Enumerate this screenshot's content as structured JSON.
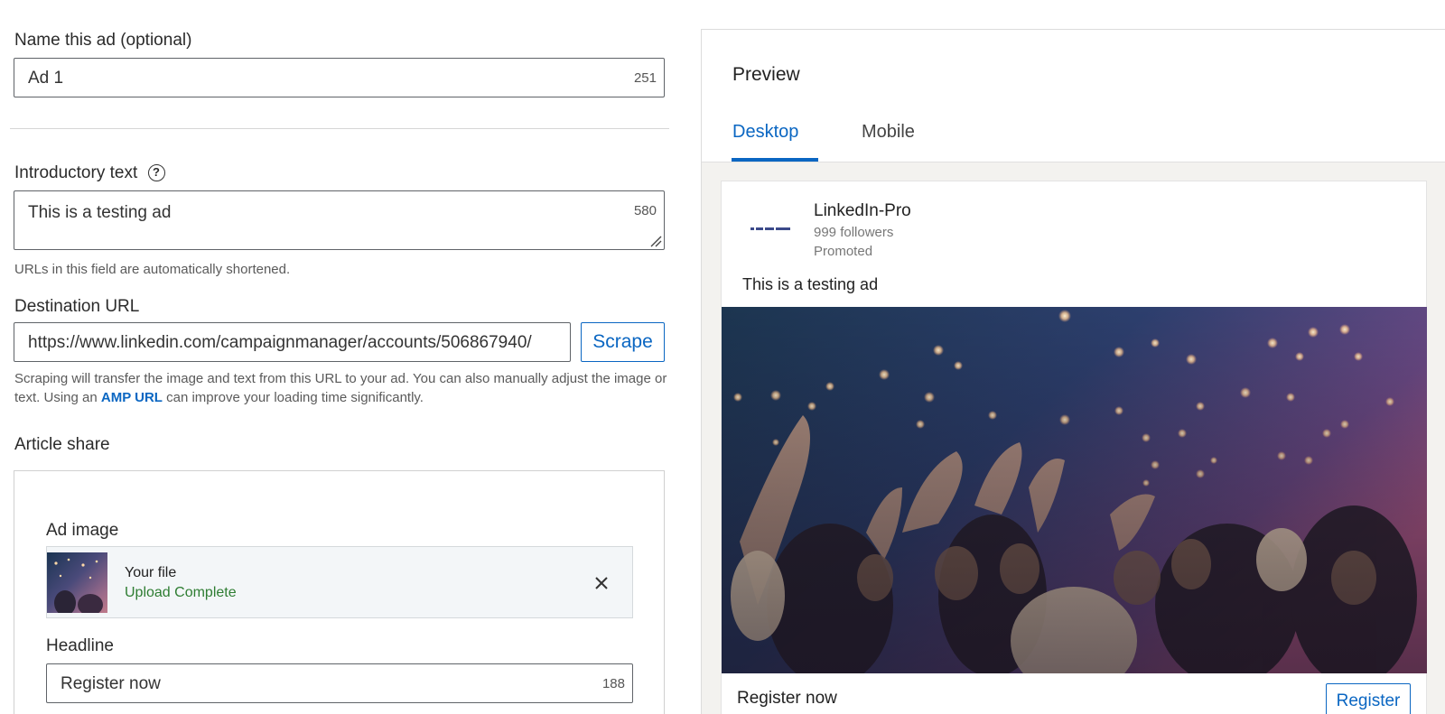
{
  "form": {
    "name_label": "Name this ad (optional)",
    "name_value": "Ad 1",
    "name_counter": "251",
    "intro_label": "Introductory text",
    "intro_value": "This is a testing ad",
    "intro_counter": "580",
    "intro_help": "URLs in this field are automatically shortened.",
    "dest_label": "Destination URL",
    "dest_value": "https://www.linkedin.com/campaignmanager/accounts/506867940/",
    "scrape_label": "Scrape",
    "scrape_help_pre": "Scraping will transfer the image and text from this URL to your ad. You can also manually adjust the image or text. Using an ",
    "scrape_help_link": "AMP URL",
    "scrape_help_post": " can improve your loading time significantly.",
    "article_share_label": "Article share",
    "ad_image_label": "Ad image",
    "file_name": "Your file",
    "file_status": "Upload Complete",
    "headline_label": "Headline",
    "headline_value": "Register now",
    "headline_counter": "188"
  },
  "preview": {
    "title": "Preview",
    "tabs": [
      "Desktop",
      "Mobile"
    ],
    "active_tab": "Desktop",
    "company_name": "LinkedIn-Pro",
    "followers": "999 followers",
    "promoted": "Promoted",
    "post_text": "This is a testing ad",
    "headline": "Register now",
    "cta_label": "Register"
  },
  "colors": {
    "accent": "#0a66c2",
    "success": "#2e7d32",
    "border": "#5f6368"
  },
  "icons": {
    "help": "help-circle-icon",
    "remove": "close-icon",
    "resize": "resize-handle-icon"
  }
}
